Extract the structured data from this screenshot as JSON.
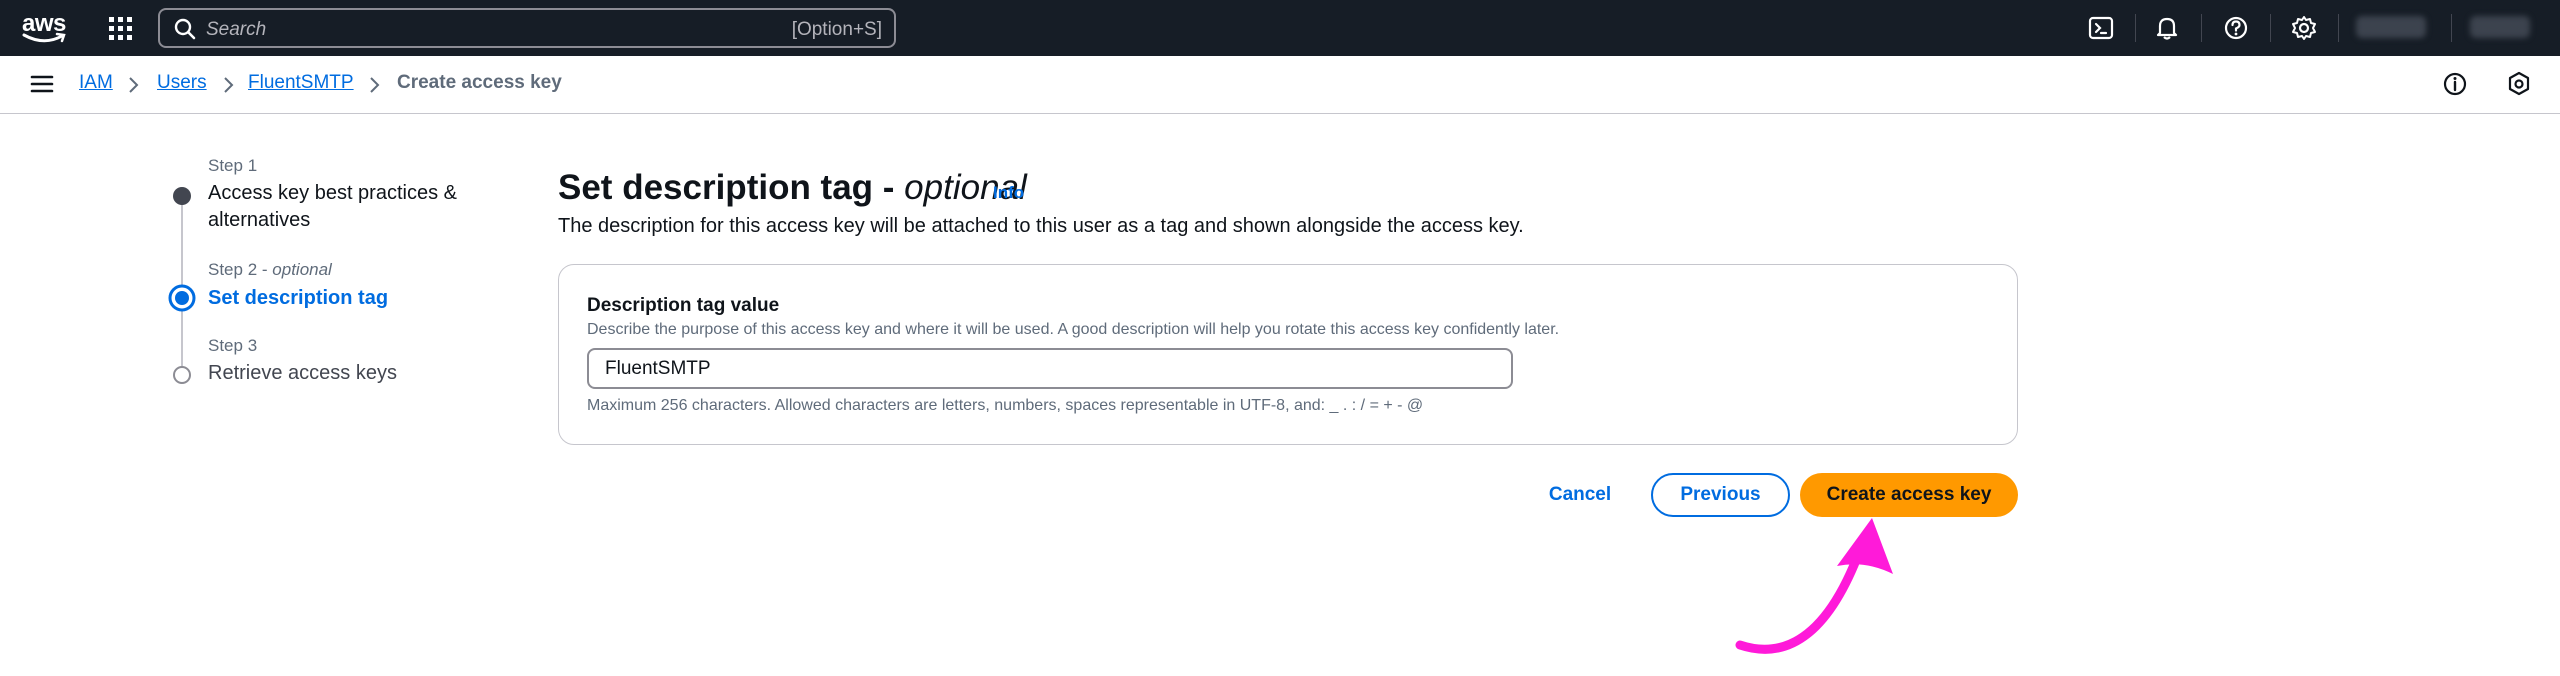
{
  "topnav": {
    "logo_text": "aws",
    "search_placeholder": "Search",
    "search_shortcut": "[Option+S]",
    "icons": [
      "cloudshell-icon",
      "bell-icon",
      "help-icon",
      "gear-icon"
    ]
  },
  "breadcrumb": {
    "items": [
      {
        "label": "IAM"
      },
      {
        "label": "Users"
      },
      {
        "label": "FluentSMTP"
      },
      {
        "label": "Create access key"
      }
    ]
  },
  "steps": [
    {
      "label": "Step 1",
      "title_line1": "Access key best practices &",
      "title_line2": "alternatives"
    },
    {
      "label": "Step 2 -",
      "label_optional": "optional",
      "title": "Set description tag"
    },
    {
      "label": "Step 3",
      "title": "Retrieve access keys"
    }
  ],
  "main": {
    "title": "Set description tag -",
    "title_optional": "optional",
    "info_link": "Info",
    "description": "The description for this access key will be attached to this user as a tag and shown alongside the access key."
  },
  "form": {
    "label": "Description tag value",
    "description": "Describe the purpose of this access key and where it will be used. A good description will help you rotate this access key confidently later.",
    "value": "FluentSMTP",
    "hint": "Maximum 256 characters. Allowed characters are letters, numbers, spaces representable in UTF-8, and: _ . : / = + - @"
  },
  "actions": {
    "cancel": "Cancel",
    "previous": "Previous",
    "create": "Create access key"
  },
  "colors": {
    "nav_bg": "#161d26",
    "link": "#006ce0",
    "primary": "#ff9900",
    "annotation_arrow": "#ff1ad9"
  }
}
